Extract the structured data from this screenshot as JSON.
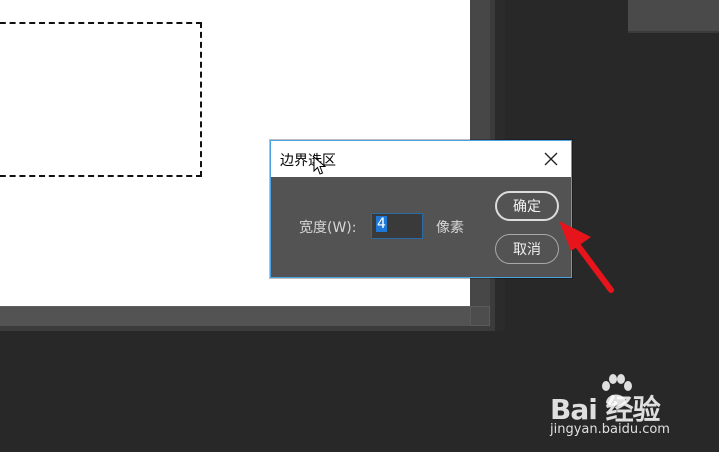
{
  "dialog": {
    "title": "边界选区",
    "width_label": "宽度(W):",
    "width_value": "4",
    "unit_label": "像素",
    "ok_label": "确定",
    "cancel_label": "取消"
  },
  "watermark": {
    "brand_text": "Bai  经验",
    "sub_text": "jingyan.baidu.com"
  },
  "colors": {
    "accent": "#4aa3df",
    "annotation_arrow": "#e8141c",
    "workspace_bg": "#282828",
    "dialog_bg": "#535353"
  },
  "icons": [
    "close-icon",
    "mouse-cursor-icon",
    "red-arrow-annotation",
    "paw-icon"
  ]
}
